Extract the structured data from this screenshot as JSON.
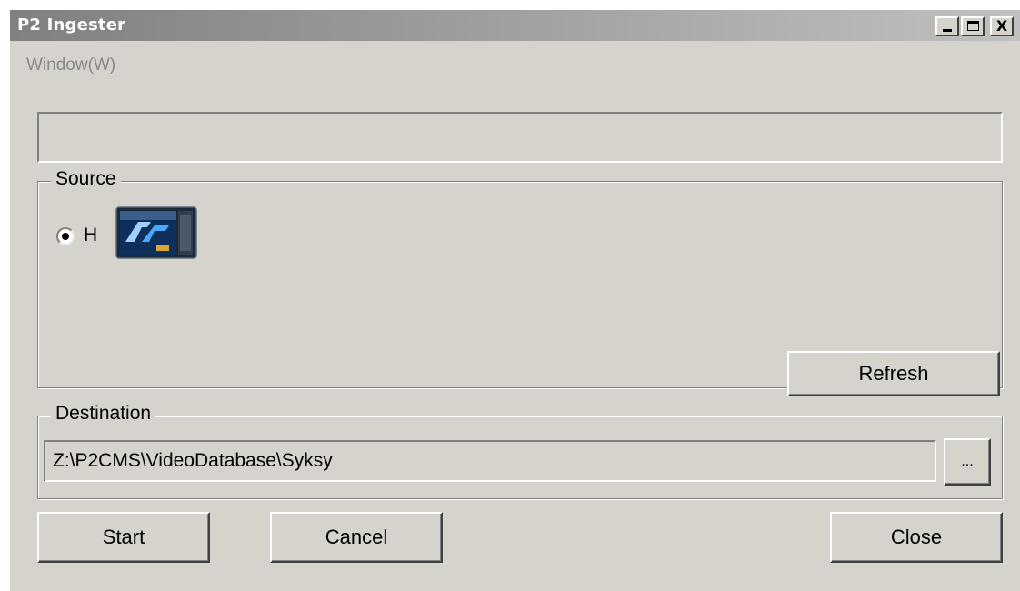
{
  "window": {
    "title": "P2 Ingester",
    "controls": {
      "minimize_icon": "minimize-icon",
      "maximize_icon": "maximize-icon",
      "close_label": "X"
    }
  },
  "menu": {
    "items": [
      {
        "label": "Window(W)"
      }
    ]
  },
  "status": {
    "text": ""
  },
  "source": {
    "legend": "Source",
    "drives": [
      {
        "label": "H",
        "selected": true,
        "icon": "p2-card-icon"
      }
    ],
    "refresh_label": "Refresh"
  },
  "destination": {
    "legend": "Destination",
    "path": "Z:\\P2CMS\\VideoDatabase\\Syksy",
    "browse_label": "..."
  },
  "actions": {
    "start_label": "Start",
    "cancel_label": "Cancel",
    "close_label": "Close"
  },
  "colors": {
    "window_background": "#d6d3cc",
    "titlebar_start": "#808080",
    "titlebar_end": "#c0c0c0",
    "disabled_text": "#8a8a8a"
  }
}
